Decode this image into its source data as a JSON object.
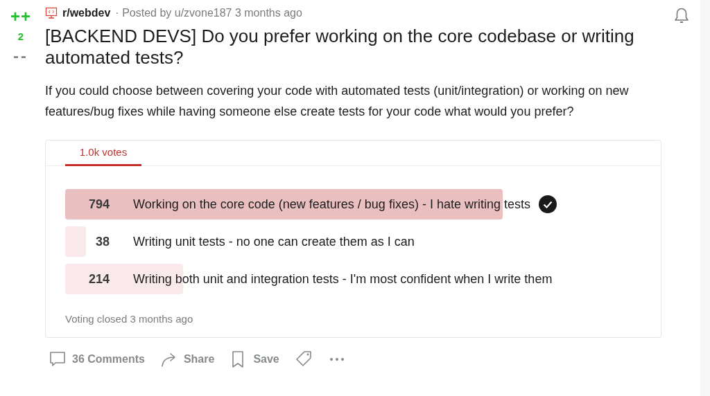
{
  "vote": {
    "up": "++",
    "score": "2",
    "down": "--"
  },
  "post": {
    "subreddit": "r/webdev",
    "meta": "· Posted by u/zvone187 3 months ago",
    "title": "[BACKEND DEVS] Do you prefer working on the core codebase or writing automated tests?",
    "body": "If you could choose between covering your code with automated tests (unit/integration) or working on new features/bug fixes while having someone else create tests for your code what would you prefer?"
  },
  "poll": {
    "tabs": [
      {
        "label": "1.0k votes",
        "selected": true
      }
    ],
    "options": [
      {
        "count": "794",
        "label": "Working on the core code (new features / bug fixes) - I hate writing tests",
        "selected": true
      },
      {
        "count": "38",
        "label": "Writing unit tests - no one can create them as I can",
        "selected": false
      },
      {
        "count": "214",
        "label": "Writing both unit and integration tests - I'm most confident when I write them",
        "selected": false
      }
    ],
    "footer": "Voting closed 3 months ago"
  },
  "actions": [
    {
      "kind": "comments",
      "label": "36 Comments"
    },
    {
      "kind": "share",
      "label": "Share"
    },
    {
      "kind": "save",
      "label": "Save"
    },
    {
      "kind": "tag"
    },
    {
      "kind": "more"
    }
  ]
}
